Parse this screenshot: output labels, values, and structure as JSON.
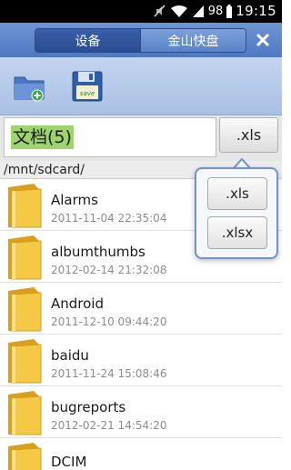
{
  "status_bar": {
    "battery": "98",
    "time": "19:15",
    "icons": [
      "mute-icon",
      "wifi-icon",
      "signal-icon",
      "battery-icon"
    ]
  },
  "title_bar": {
    "tabs": [
      {
        "label": "设备",
        "active": true
      },
      {
        "label": "金山快盘",
        "active": false
      }
    ],
    "close_icon": "close-icon"
  },
  "toolbar": {
    "buttons": [
      {
        "icon": "new-folder-icon"
      },
      {
        "icon": "save-icon",
        "badge": "save"
      }
    ]
  },
  "filter": {
    "search_text": "文档(5)",
    "extension_button": ".xls"
  },
  "path": "/mnt/sdcard/",
  "files": [
    {
      "name": "Alarms",
      "date": "2011-11-04 22:35:04"
    },
    {
      "name": "albumthumbs",
      "date": "2012-02-14 21:32:08"
    },
    {
      "name": "Android",
      "date": "2011-12-10 09:44:20"
    },
    {
      "name": "baidu",
      "date": "2011-11-24 15:08:46"
    },
    {
      "name": "bugreports",
      "date": "2012-02-21 14:54:20"
    },
    {
      "name": "DCIM",
      "date": ""
    }
  ],
  "extension_popup": {
    "options": [
      ".xls",
      ".xlsx"
    ]
  },
  "colors": {
    "title_bar": "#5a82c6",
    "highlight": "#9fd36e",
    "popup_border": "#7392c8",
    "folder": "#f2c33b"
  }
}
